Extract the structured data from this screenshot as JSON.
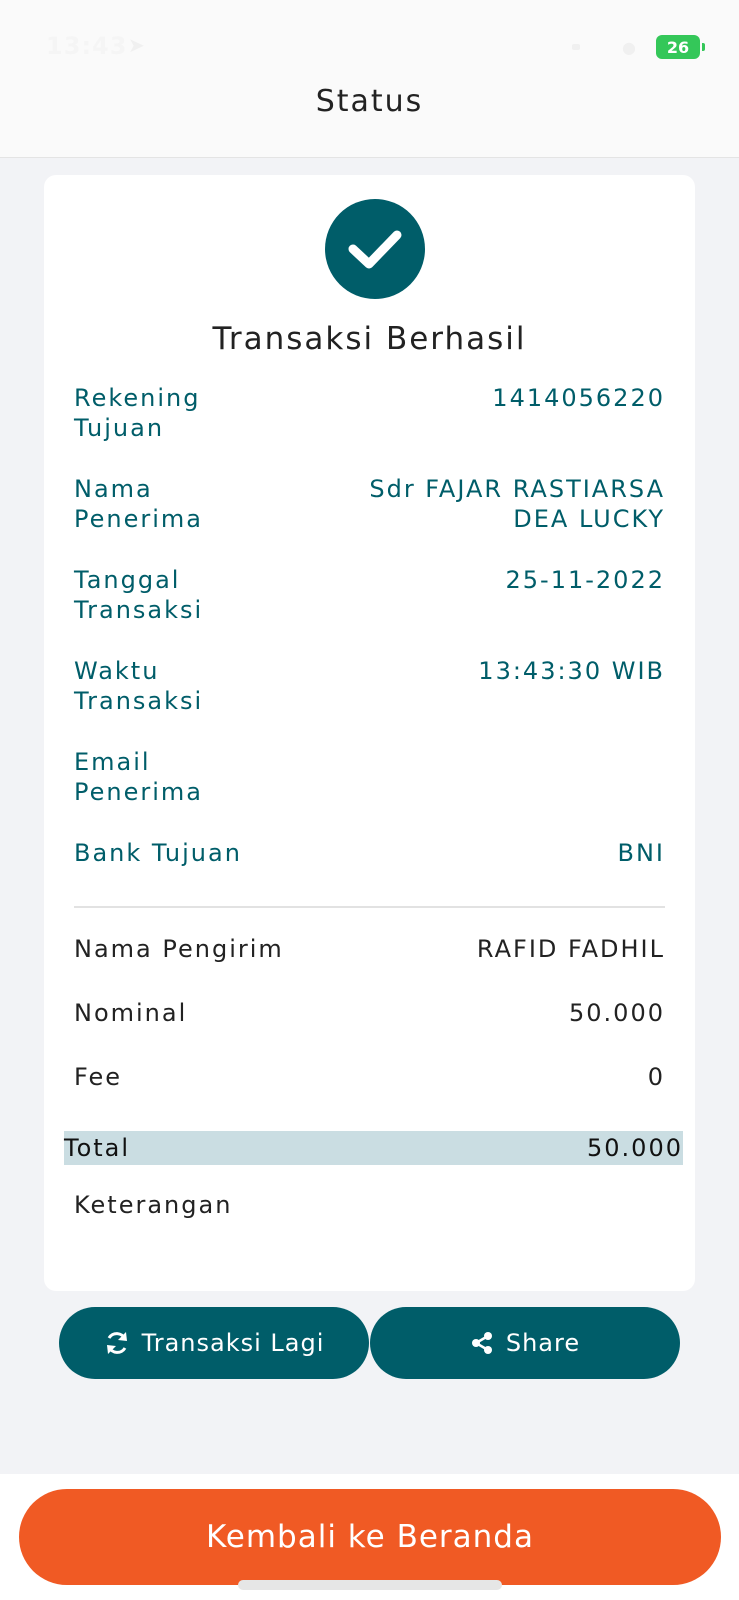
{
  "status_bar": {
    "time": "13:43",
    "battery": "26"
  },
  "header": {
    "title": "Status"
  },
  "card": {
    "title": "Transaksi Berhasil",
    "details": [
      {
        "label": "Rekening Tujuan",
        "value": "1414056220"
      },
      {
        "label": "Nama Penerima",
        "value": "Sdr FAJAR RASTIARSA DEA LUCKY"
      },
      {
        "label": "Tanggal Transaksi",
        "value": "25-11-2022"
      },
      {
        "label": "Waktu Transaksi",
        "value": "13:43:30 WIB"
      },
      {
        "label": "Email Penerima",
        "value": ""
      },
      {
        "label": "Bank Tujuan",
        "value": "BNI"
      }
    ],
    "summary": [
      {
        "label": "Nama Pengirim",
        "value": "RAFID FADHIL"
      },
      {
        "label": "Nominal",
        "value": "50.000"
      },
      {
        "label": "Fee",
        "value": "0"
      }
    ],
    "total": {
      "label": "Total",
      "value": "50.000"
    },
    "note_label": "Keterangan"
  },
  "actions": {
    "again_label": "Transaksi Lagi",
    "share_label": "Share",
    "home_label": "Kembali ke Beranda"
  },
  "colors": {
    "primary": "#005d69",
    "accent": "#f05a24",
    "total_bg": "#cadde2",
    "battery": "#34c759"
  }
}
